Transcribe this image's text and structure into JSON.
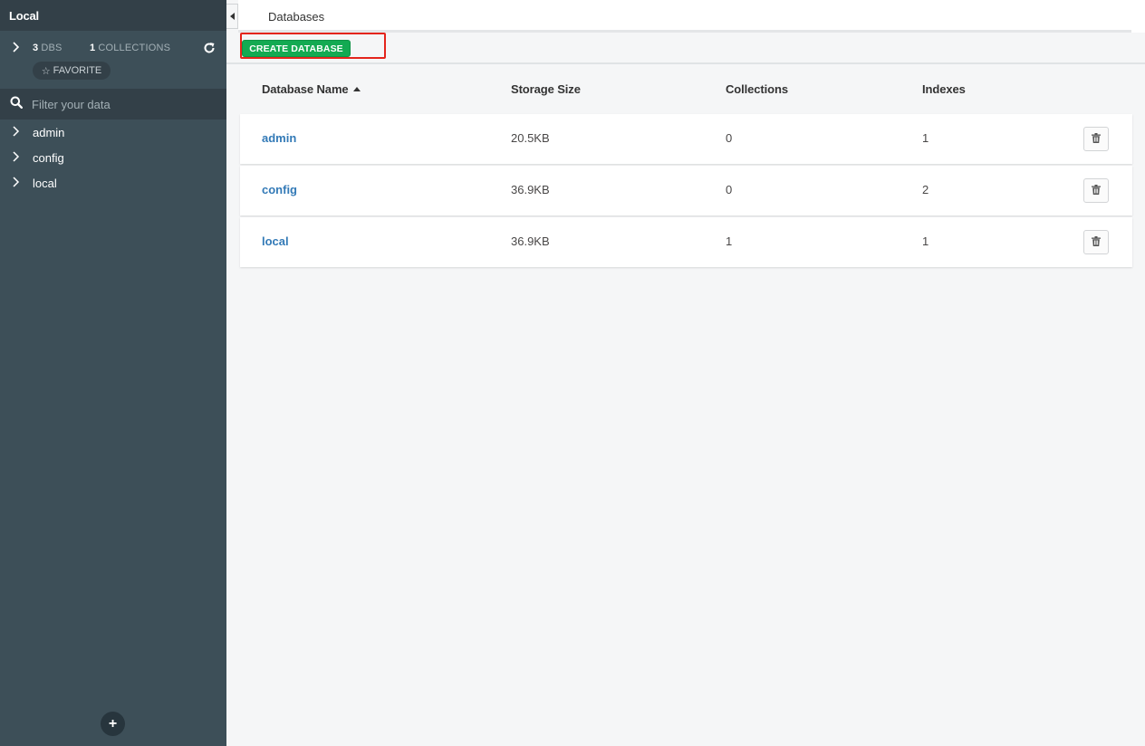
{
  "sidebar": {
    "title": "Local",
    "stats": {
      "dbs_count": "3",
      "dbs_label": "DBS",
      "collections_count": "1",
      "collections_label": "COLLECTIONS"
    },
    "favorite_label": "FAVORITE",
    "filter_placeholder": "Filter your data",
    "databases": [
      {
        "label": "admin"
      },
      {
        "label": "config"
      },
      {
        "label": "local"
      }
    ],
    "add_label": "+"
  },
  "tabs": [
    {
      "label": "Databases"
    }
  ],
  "toolbar": {
    "create_label": "CREATE DATABASE"
  },
  "table": {
    "headers": {
      "name": "Database Name",
      "storage": "Storage Size",
      "collections": "Collections",
      "indexes": "Indexes"
    },
    "rows": [
      {
        "name": "admin",
        "storage": "20.5KB",
        "collections": "0",
        "indexes": "1"
      },
      {
        "name": "config",
        "storage": "36.9KB",
        "collections": "0",
        "indexes": "2"
      },
      {
        "name": "local",
        "storage": "36.9KB",
        "collections": "1",
        "indexes": "1"
      }
    ]
  },
  "colors": {
    "sidebar_bg": "#3d4f58",
    "sidebar_dark": "#334048",
    "accent_green": "#13aa52",
    "link_blue": "#337ab7",
    "highlight_red": "#e4251c"
  }
}
